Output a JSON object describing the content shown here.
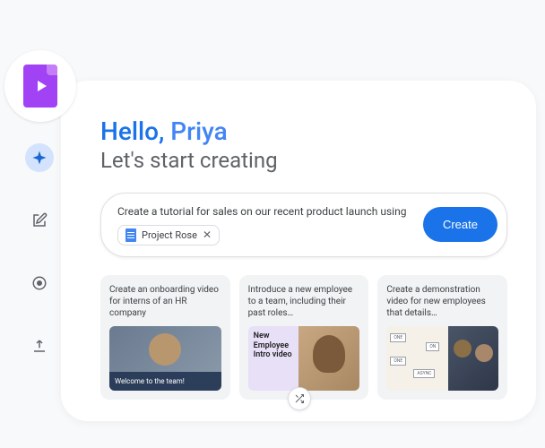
{
  "greeting": {
    "hello": "Hello, ",
    "name": "Priya",
    "subtitle": "Let's start creating"
  },
  "prompt": {
    "text": "Create a tutorial for sales on our recent product launch using",
    "chip_label": "Project Rose",
    "create_label": "Create"
  },
  "suggestions": [
    {
      "text": "Create an onboarding video for interns of an HR company",
      "caption": "Welcome to the team!"
    },
    {
      "text": "Introduce a new employee to a team, including their past roles…",
      "overlay": "New Employee Intro video"
    },
    {
      "text": "Create a demonstration video for new employees that details…",
      "labels": [
        "ONE",
        "ON",
        "ONE",
        "ASYNC"
      ]
    }
  ]
}
